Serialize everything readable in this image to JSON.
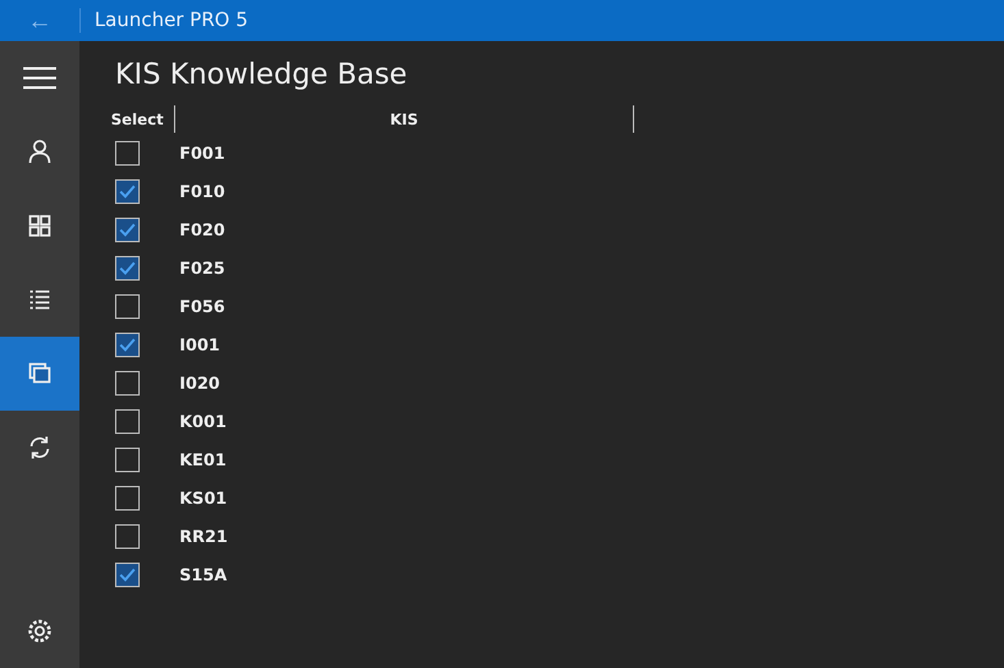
{
  "window": {
    "title": "Launcher PRO 5",
    "back_button": "←"
  },
  "sidebar": {
    "items": [
      {
        "kind": "person",
        "selected": false
      },
      {
        "kind": "grid",
        "selected": false
      },
      {
        "kind": "list",
        "selected": false
      },
      {
        "kind": "windows",
        "selected": true
      },
      {
        "kind": "sync",
        "selected": false
      }
    ],
    "footer": [
      {
        "kind": "settings",
        "selected": false
      }
    ]
  },
  "page": {
    "title": "KIS Knowledge Base"
  },
  "table": {
    "columns": [
      "Select",
      "KIS"
    ],
    "rows": [
      {
        "kis": "F001",
        "checked": false
      },
      {
        "kis": "F010",
        "checked": true
      },
      {
        "kis": "F020",
        "checked": true
      },
      {
        "kis": "F025",
        "checked": true
      },
      {
        "kis": "F056",
        "checked": false
      },
      {
        "kis": "I001",
        "checked": true
      },
      {
        "kis": "I020",
        "checked": false
      },
      {
        "kis": "K001",
        "checked": false
      },
      {
        "kis": "KE01",
        "checked": false
      },
      {
        "kis": "KS01",
        "checked": false
      },
      {
        "kis": "RR21",
        "checked": false
      },
      {
        "kis": "S15A",
        "checked": true
      }
    ]
  }
}
